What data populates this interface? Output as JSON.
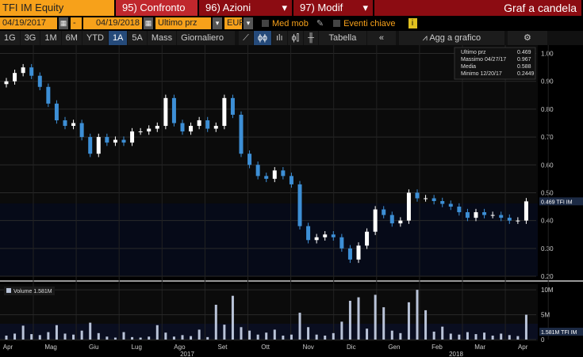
{
  "header": {
    "ticker": "TFI IM Equity",
    "compare": "95) Confronto",
    "actions": "96) Azioni",
    "modify": "97) Modif",
    "title": "Graf a candela"
  },
  "controls": {
    "start_date": "04/19/2017",
    "dash": "-",
    "end_date": "04/19/2018",
    "field": "Ultimo prz",
    "currency": "EUR",
    "moving_avg": "Med mob",
    "key_events": "Eventi chiave",
    "info": "i"
  },
  "toolbar": {
    "ranges": [
      "1G",
      "3G",
      "1M",
      "6M",
      "YTD",
      "1A",
      "5A",
      "Mass"
    ],
    "active_range": "1A",
    "period": "Giornaliero ▼",
    "table": "Tabella",
    "collapse": "«",
    "add_chart": "Agg a grafico",
    "settings": "⚙"
  },
  "colors": {
    "up": "#ffffff",
    "down": "#3d8fd6",
    "volume": "#b9c3d8",
    "header_orange": "#f7a11a",
    "header_red": "#c0272d"
  },
  "chart_data": {
    "type": "candlestick",
    "legend": [
      {
        "label": "Ultimo prz",
        "value": "0.469"
      },
      {
        "label": "Massimo 04/27/17",
        "value": "0.967"
      },
      {
        "label": "Media",
        "value": "0.588"
      },
      {
        "label": "Minimo 12/20/17",
        "value": "0.2449"
      }
    ],
    "last_label": "0.469 TFI IM",
    "yticks": [
      "1.00",
      "0.90",
      "0.80",
      "0.70",
      "0.60",
      "0.50",
      "0.40",
      "0.30",
      "0.20"
    ],
    "ylim": [
      0.2,
      1.03
    ],
    "closes": [
      0.9,
      0.93,
      0.95,
      0.92,
      0.88,
      0.82,
      0.76,
      0.74,
      0.75,
      0.7,
      0.64,
      0.7,
      0.68,
      0.69,
      0.68,
      0.72,
      0.72,
      0.73,
      0.74,
      0.84,
      0.75,
      0.72,
      0.74,
      0.76,
      0.73,
      0.74,
      0.84,
      0.78,
      0.64,
      0.6,
      0.56,
      0.55,
      0.58,
      0.56,
      0.53,
      0.38,
      0.33,
      0.34,
      0.35,
      0.34,
      0.3,
      0.26,
      0.31,
      0.36,
      0.44,
      0.42,
      0.39,
      0.4,
      0.5,
      0.48,
      0.48,
      0.47,
      0.46,
      0.45,
      0.43,
      0.41,
      0.43,
      0.42,
      0.42,
      0.41,
      0.4,
      0.4,
      0.469
    ],
    "volume_label": "Volume 1.581M",
    "volume_last": "1.581M TFI IM",
    "volume_yticks": [
      "10M",
      "5M",
      "0"
    ],
    "volume_ylim": [
      0,
      10.5
    ],
    "volumes": [
      0.8,
      1.2,
      2.8,
      1.1,
      0.9,
      1.5,
      2.9,
      1.2,
      1.0,
      1.8,
      3.4,
      1.3,
      0.6,
      0.4,
      1.5,
      0.5,
      0.4,
      0.6,
      2.9,
      1.4,
      0.6,
      0.9,
      0.7,
      2.0,
      0.5,
      7.0,
      3.0,
      8.8,
      2.5,
      1.8,
      1.0,
      1.4,
      2.0,
      0.8,
      1.0,
      5.4,
      2.5,
      1.0,
      0.8,
      1.3,
      3.6,
      7.8,
      8.5,
      2.2,
      9.0,
      6.5,
      1.8,
      1.3,
      7.5,
      10.0,
      5.9,
      1.6,
      2.6,
      1.2,
      1.0,
      1.5,
      1.1,
      1.4,
      0.8,
      1.2,
      0.9,
      0.7,
      5.0
    ],
    "months": [
      "Apr",
      "Mag",
      "Giu",
      "Lug",
      "Ago",
      "Set",
      "Ott",
      "Nov",
      "Dic",
      "Gen",
      "Feb",
      "Mar",
      "Apr"
    ],
    "years": [
      "2017",
      "2018"
    ]
  }
}
